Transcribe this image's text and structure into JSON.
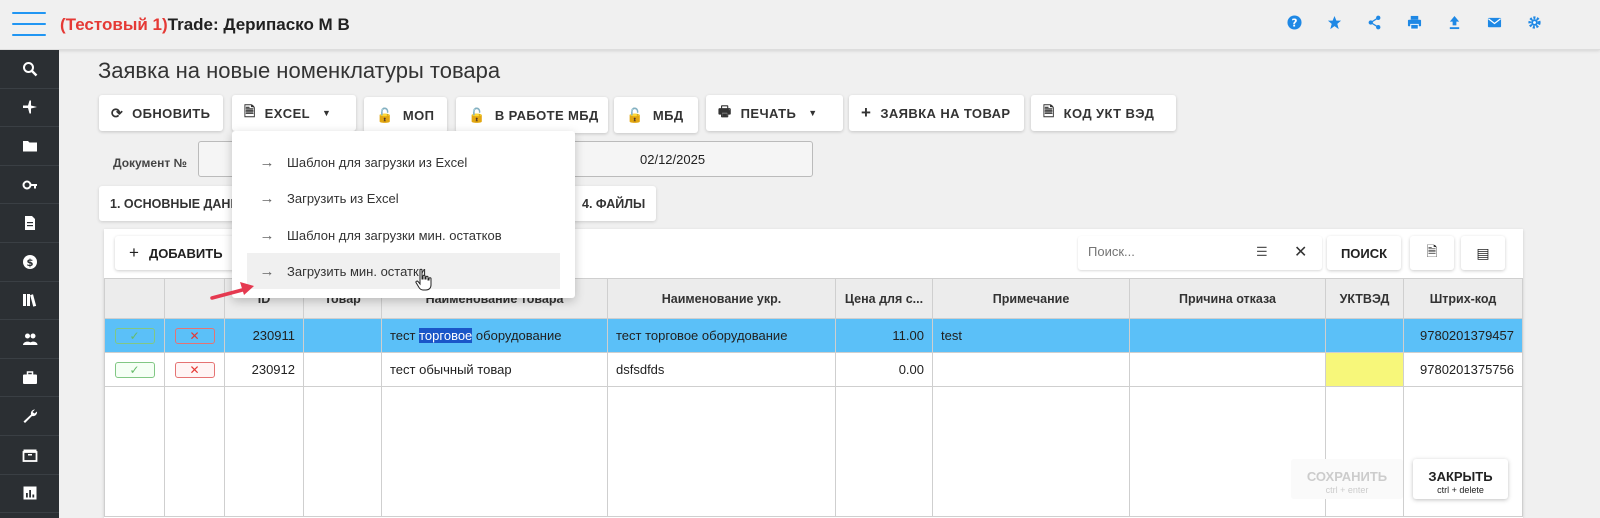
{
  "header": {
    "test_label": "(Тестовый 1)",
    "app_user": "Trade: Дерипаско М В",
    "icons": [
      "help-icon",
      "star-icon",
      "share-icon",
      "print-icon",
      "upload-icon",
      "mail-icon",
      "settings-icon"
    ]
  },
  "sidebar": {
    "items": [
      "search-icon",
      "plane-icon",
      "folder-icon",
      "key-icon",
      "document-icon",
      "dollar-icon",
      "books-icon",
      "users-icon",
      "briefcase-icon",
      "wrench-icon",
      "box-icon",
      "chart-icon"
    ]
  },
  "page": {
    "title": "Заявка на новые номенклатуры товара"
  },
  "toolbar": {
    "refresh": "ОБНОВИТЬ",
    "excel": "EXCEL",
    "mop": "МОП",
    "in_work_mbd": "В РАБОТЕ МБД",
    "mbd": "МБД",
    "print": "ПЕЧАТЬ",
    "request": "ЗАЯВКА НА ТОВАР",
    "code": "КОД УКТ ВЭД"
  },
  "document": {
    "label": "Документ №",
    "date": "02/12/2025"
  },
  "tabs": {
    "main": "1. ОСНОВНЫЕ ДАНН",
    "files": "4. ФАЙЛЫ"
  },
  "dropdown": {
    "items": [
      "Шаблон для загрузки из Excel",
      "Загрузить из Excel",
      "Шаблон для загрузки мин. остатков",
      "Загрузить мин. остатки"
    ]
  },
  "grid": {
    "add": "ДОБАВИТЬ",
    "search_placeholder": "Поиск...",
    "search_button": "ПОИСК",
    "columns": [
      "",
      "",
      "ID",
      "Товар",
      "Наименование товара",
      "Наименование укр.",
      "Цена для с...",
      "Примечание",
      "Причина отказа",
      "УКТВЭД",
      "Штрих-код"
    ],
    "rows": [
      {
        "id": "230911",
        "product": "",
        "name_pre": "тест ",
        "name_hl": "торговое",
        "name_post": " оборудование",
        "name_ukr": "тест торговое оборудование",
        "price": "11.00",
        "note": "test",
        "reason": "",
        "uktved": "",
        "barcode": "9780201379457"
      },
      {
        "id": "230912",
        "product": "",
        "name_pre": "тест обычный товар",
        "name_hl": "",
        "name_post": "",
        "name_ukr": "dsfsdfds",
        "price": "0.00",
        "note": "",
        "reason": "",
        "uktved": "",
        "barcode": "9780201375756"
      }
    ]
  },
  "footer": {
    "save": "СОХРАНИТЬ",
    "save_hint": "ctrl + enter",
    "close": "ЗАКРЫТЬ",
    "close_hint": "ctrl + delete"
  },
  "colors": {
    "accent": "#2196f3",
    "test_label": "#e53935",
    "selected_row": "#5bc0f8",
    "sidebar_bg": "#2b2f33",
    "uktved_missing": "#f7f77a"
  }
}
